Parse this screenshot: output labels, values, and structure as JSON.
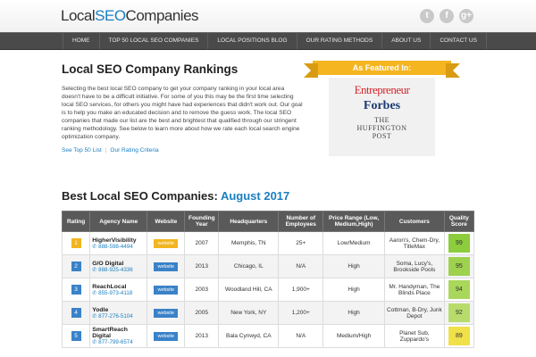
{
  "logo": {
    "part1": "Local",
    "part2": "SEO",
    "part3": "Companies"
  },
  "social": [
    "t",
    "f",
    "g+"
  ],
  "nav": [
    "HOME",
    "TOP 50 LOCAL SEO COMPANIES",
    "LOCAL POSITIONS BLOG",
    "OUR RATING METHODS",
    "ABOUT US",
    "CONTACT US"
  ],
  "intro": {
    "title": "Local SEO Company Rankings",
    "body": "Selecting the best local SEO company to get your company ranking in your local area doesn't have to be a difficult initiative. For some of you this may be the first time selecting local SEO services, for others you might have had experiences that didn't work out. Our goal is to help you make an educated decision and to remove the guess work. The local SEO companies that made our list are the best and brightest that qualified through our stringent ranking methodology. See below to learn more about how we rate each local search engine optimization company.",
    "link1": "See Top 50 List",
    "link2": "Our Rating Criteria"
  },
  "featured": {
    "label": "As Featured In:",
    "entrepreneur": "Entrepreneur",
    "forbes": "Forbes",
    "huff1": "THE",
    "huff2": "HUFFINGTON",
    "huff3": "POST"
  },
  "best": {
    "title": "Best Local SEO Companies:",
    "month": "August 2017"
  },
  "table": {
    "headers": [
      "Rating",
      "Agency Name",
      "Website",
      "Founding Year",
      "Headquarters",
      "Number of Employees",
      "Price Range (Low, Medium,High)",
      "Customers",
      "Quality Score"
    ],
    "rows": [
      {
        "rank": "1",
        "name": "HigherVisibility",
        "phone": "888-598-4494",
        "website": "website",
        "year": "2007",
        "hq": "Memphis, TN",
        "employees": "25+",
        "price": "Low/Medium",
        "customers": "Aaron's, Chem-Dry, TitleMax",
        "score": "99"
      },
      {
        "rank": "2",
        "name": "G/O Digital",
        "phone": "888-925-4336",
        "website": "website",
        "year": "2013",
        "hq": "Chicago, IL",
        "employees": "N/A",
        "price": "High",
        "customers": "Soma, Lucy's, Brookside Pools",
        "score": "95"
      },
      {
        "rank": "3",
        "name": "ReachLocal",
        "phone": "855-973-4118",
        "website": "website",
        "year": "2003",
        "hq": "Woodland Hill, CA",
        "employees": "1,900+",
        "price": "High",
        "customers": "Mr. Handyman, The Blinds Place",
        "score": "94"
      },
      {
        "rank": "4",
        "name": "Yodle",
        "phone": "877-276-5104",
        "website": "website",
        "year": "2005",
        "hq": "New York, NY",
        "employees": "1,200+",
        "price": "High",
        "customers": "Cottman, B-Dry, Junk Depot",
        "score": "92"
      },
      {
        "rank": "5",
        "name": "SmartReach Digital",
        "phone": "877-799-6574",
        "website": "website",
        "year": "2013",
        "hq": "Bala Cynwyd, CA",
        "employees": "N/A",
        "price": "Medium/High",
        "customers": "Planet Sub, Zuppardo's",
        "score": "89"
      }
    ],
    "score_colors": [
      "#8dcc3c",
      "#9ed24e",
      "#a9d75c",
      "#b8dc6c",
      "#f0e04a"
    ]
  }
}
